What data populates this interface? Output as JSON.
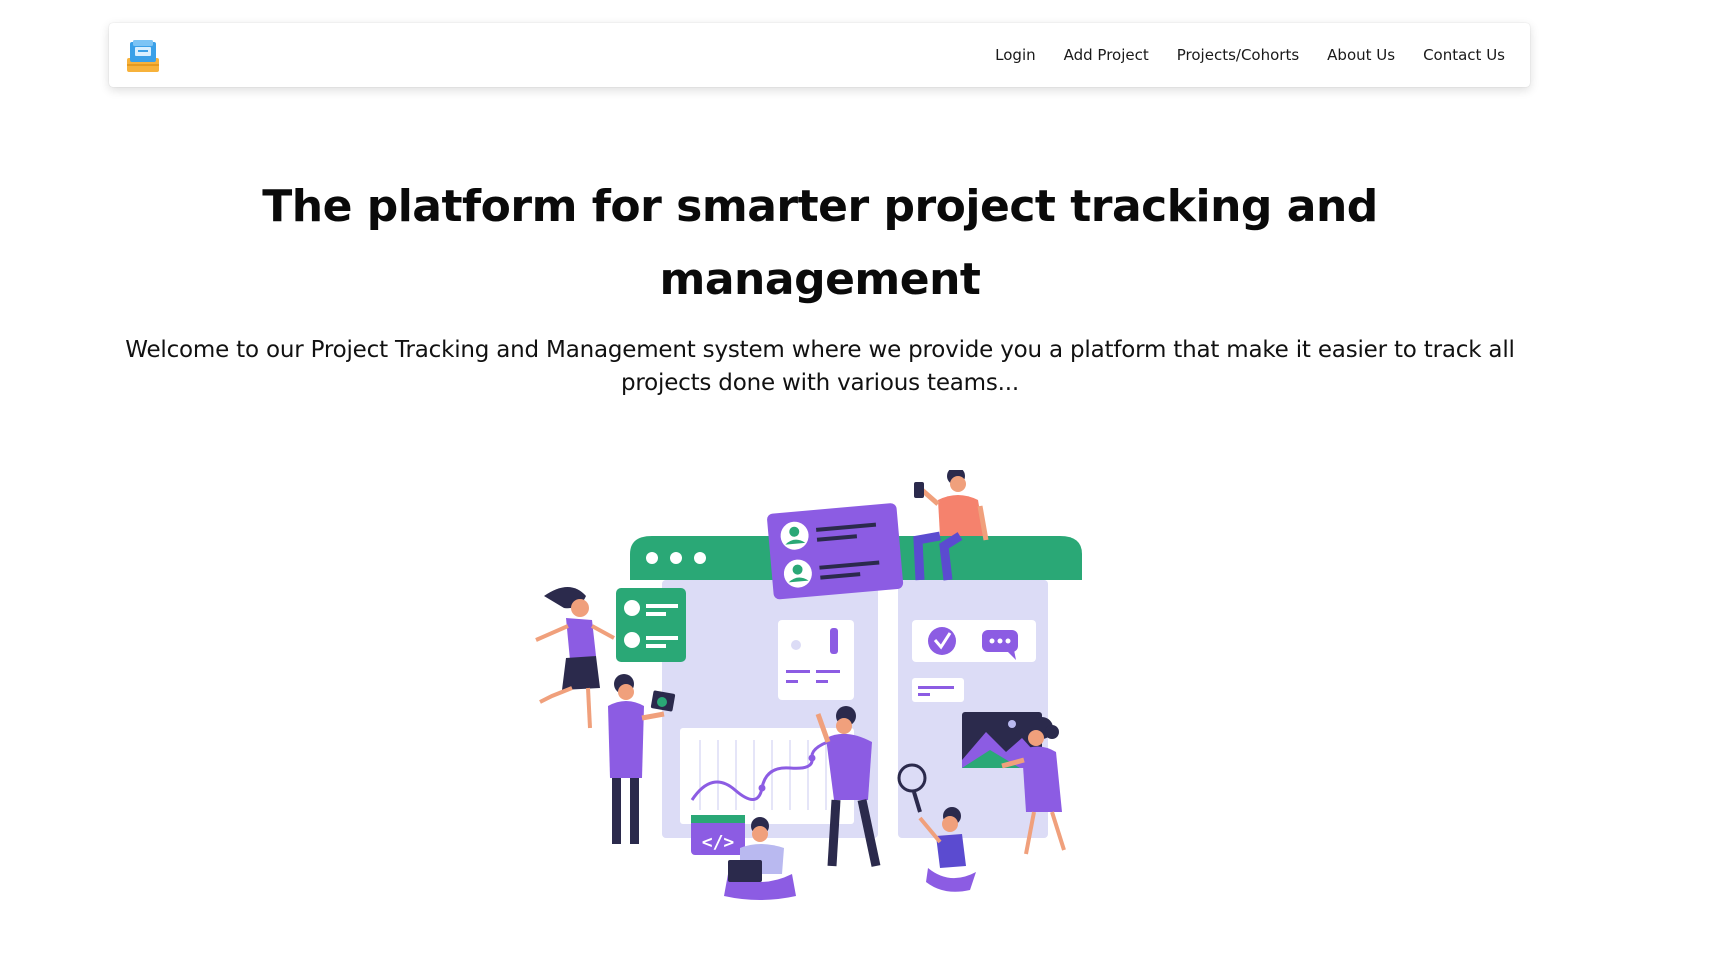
{
  "nav": {
    "logo": "project-tracker-logo",
    "links": [
      "Login",
      "Add Project",
      "Projects/Cohorts",
      "About Us",
      "Contact Us"
    ]
  },
  "hero": {
    "title": "The platform for smarter project tracking and management",
    "subtitle": "Welcome to our Project Tracking and Management system where we provide you a platform that make it easier to track all projects done with various teams..."
  },
  "illustration": {
    "name": "team-collaboration-illustration",
    "code_tag": "</>"
  },
  "colors": {
    "green": "#2aa876",
    "purple": "#8c5ce3",
    "lavender": "#dcdcf6",
    "coral": "#f5826d",
    "navy": "#2b2a4c"
  }
}
